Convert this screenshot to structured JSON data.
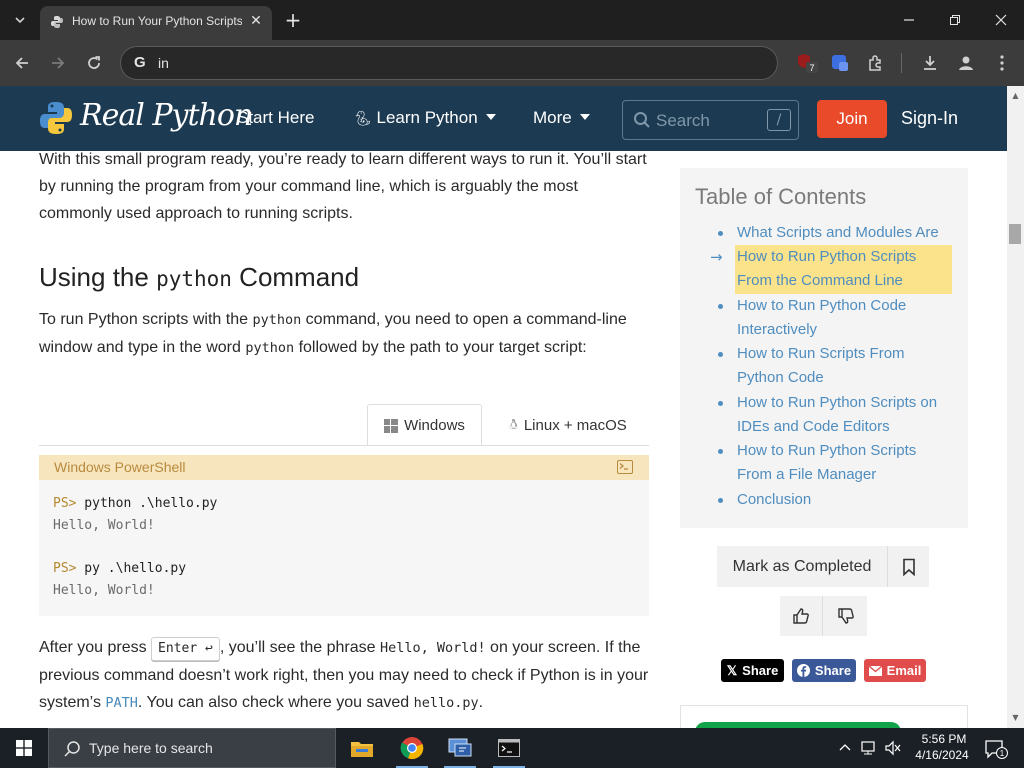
{
  "browser": {
    "tab_title": "How to Run Your Python Scripts",
    "omnibox_text": "in",
    "extension_badge": "7"
  },
  "site": {
    "logo_text": "Real Python",
    "nav": {
      "start_here": "Start Here",
      "learn_python": "Learn Python",
      "more": "More"
    },
    "search_placeholder": "Search",
    "search_shortcut": "/",
    "join": "Join",
    "sign_in": "Sign-In"
  },
  "article": {
    "intro_text": "With this small program ready, you’re ready to learn different ways to run it. You’ll start by running the program from your command line, which is arguably the most commonly used approach to running scripts.",
    "heading_pre": "Using the ",
    "heading_code": "python",
    "heading_post": " Command",
    "p2_a": "To run Python scripts with the ",
    "p2_code1": "python",
    "p2_b": " command, you need to open a command-line window and type in the word ",
    "p2_code2": "python",
    "p2_c": " followed by the path to your target script:",
    "tabs": {
      "windows": "Windows",
      "linux": "Linux + macOS"
    },
    "code_block": {
      "title": "Windows PowerShell",
      "prompt": "PS>",
      "line1_cmd": " python .\\hello.py",
      "line1_out": "Hello, World!",
      "line2_cmd": " py .\\hello.py",
      "line2_out": "Hello, World!"
    },
    "p3_a": "After you press ",
    "p3_key": "Enter ↩",
    "p3_b": ", you’ll see the phrase ",
    "p3_code": "Hello, World!",
    "p3_c": " on your screen. If the previous command doesn’t work right, then you may need to check if Python is in your system’s ",
    "p3_path": "PATH",
    "p3_d": ". You can also check where you saved ",
    "p3_file": "hello.py",
    "p3_e": "."
  },
  "toc": {
    "title": "Table of Contents",
    "items": [
      "What Scripts and Modules Are",
      "How to Run Python Scripts From the Command Line",
      "How to Run Python Code Interactively",
      "How to Run Scripts From Python Code",
      "How to Run Python Scripts on IDEs and Code Editors",
      "How to Run Python Scripts From a File Manager",
      "Conclusion"
    ],
    "active_index": 1
  },
  "actions": {
    "mark_completed": "Mark as Completed",
    "share_x": "Share",
    "share_facebook": "Share",
    "share_email": "Email"
  },
  "taskbar": {
    "search_placeholder": "Type here to search",
    "time": "5:56 PM",
    "date": "4/16/2024",
    "notification_count": "1"
  },
  "colors": {
    "site_header": "#1c3a52",
    "join_button": "#e84a2a",
    "toc_link": "#4f8dbf",
    "toc_highlight": "#fbe38c",
    "code_header": "#f7e5bd"
  }
}
